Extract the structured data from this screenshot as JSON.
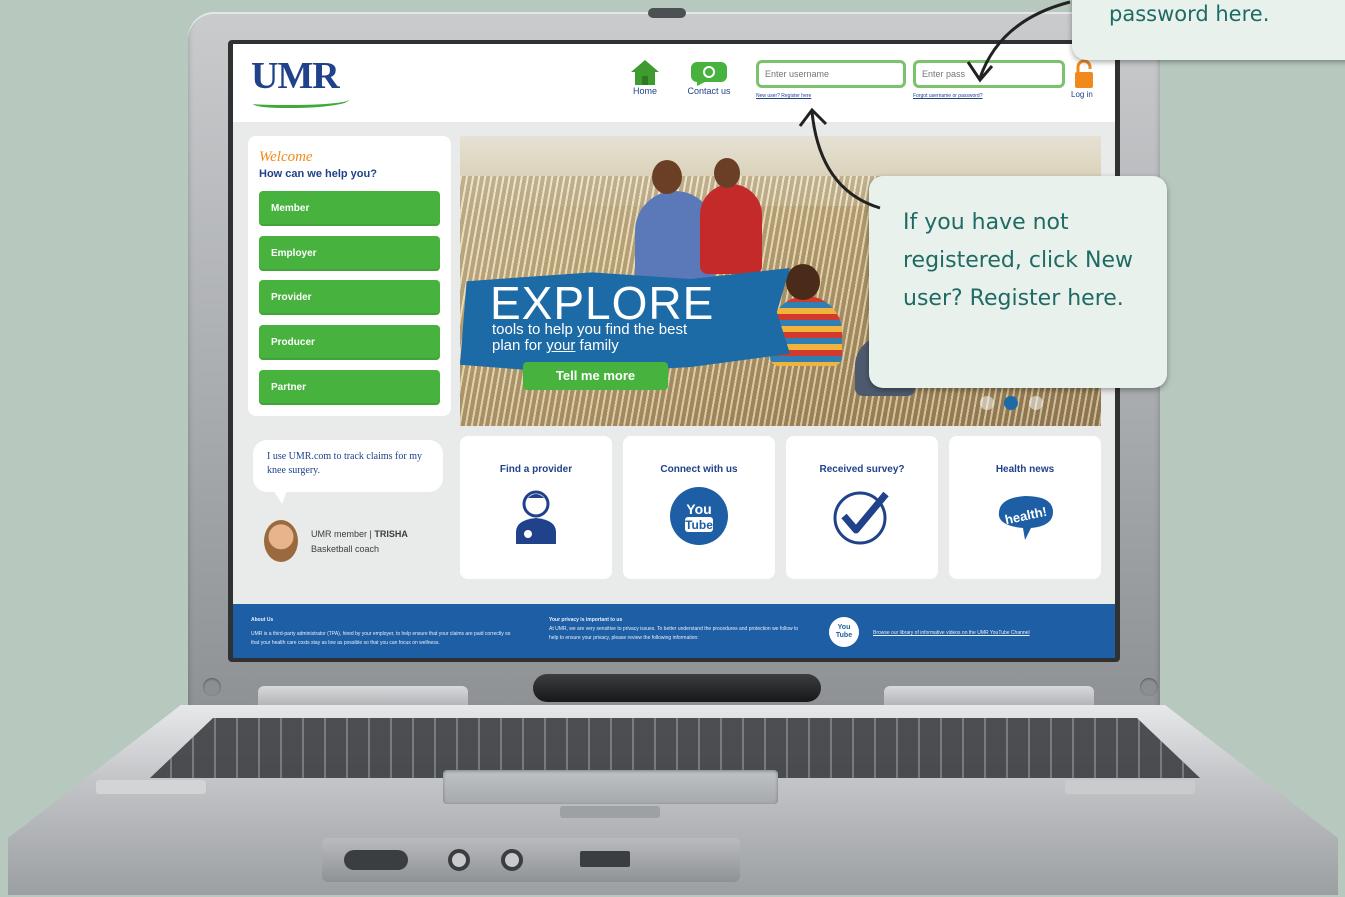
{
  "site": {
    "logo": "UMR",
    "nav": {
      "home": "Home",
      "contact": "Contact us"
    },
    "login": {
      "username_placeholder": "Enter username",
      "password_placeholder": "Enter pass",
      "register_link": "New user? Register here",
      "forgot_link": "Forgot username or password?",
      "login_label": "Log in"
    },
    "welcome": {
      "title": "Welcome",
      "subtitle": "How can we help you?",
      "roles": [
        "Member",
        "Employer",
        "Provider",
        "Producer",
        "Partner"
      ]
    },
    "hero": {
      "headline": "EXPLORE",
      "line1": "tools to help you find the best",
      "line2_prefix": "plan for ",
      "line2_underlined": "your",
      "line2_suffix": " family",
      "button": "Tell me more"
    },
    "testimonial": {
      "quote": "I use UMR.com to track claims for my knee surgery.",
      "member_label": "UMR member",
      "member_name": "TRISHA",
      "member_role": "Basketball coach"
    },
    "tiles": [
      {
        "title": "Find a provider",
        "icon": "doctor-icon"
      },
      {
        "title": "Connect with us",
        "icon": "youtube-icon"
      },
      {
        "title": "Received survey?",
        "icon": "checkmark-icon"
      },
      {
        "title": "Health news",
        "icon": "health-bubble-icon"
      }
    ],
    "footer": {
      "about_head": "About Us",
      "about_text": "UMR is a third-party administrator (TPA), hired by your employer, to help ensure that your claims are paid correctly so that your health care costs stay as low as possible so that you can focus on wellness.",
      "privacy_head": "Your privacy is important to us",
      "privacy_text": "At UMR, we are very sensitive to privacy issues. To better understand the procedures and protection we follow to help to ensure your privacy, please review the following information:",
      "youtube_link": "Browse our library of informative videos on the UMR YouTube Channel"
    }
  },
  "callouts": {
    "top": "password here.",
    "middle": "If you have not registered, click New user? Register here."
  },
  "colors": {
    "brand_blue": "#20428a",
    "brand_green": "#47b23e",
    "footer_blue": "#1e5ea5",
    "callout_text": "#1f6b64",
    "background": "#b7c9be"
  }
}
